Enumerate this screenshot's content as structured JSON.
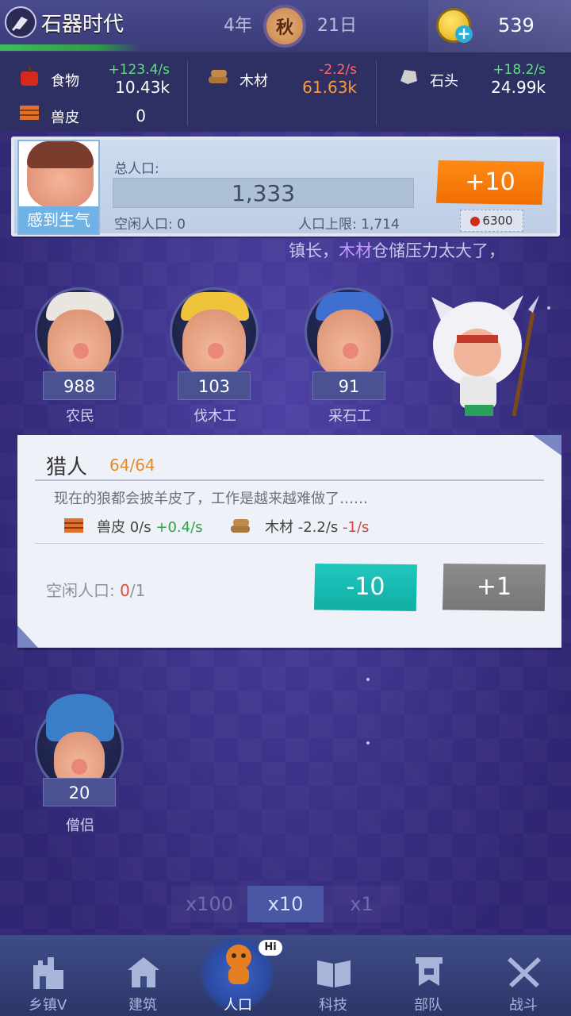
{
  "header": {
    "app_title": "石器时代",
    "year": "4年",
    "season": "秋",
    "day": "21日",
    "gold": "539"
  },
  "resources": [
    {
      "label": "食物",
      "rate": "+123.4/s",
      "amount": "10.43k",
      "icon": "apple-icon"
    },
    {
      "label": "木材",
      "rate": "-2.2/s",
      "amount": "61.63k",
      "icon": "wood-log-icon"
    },
    {
      "label": "石头",
      "rate": "+18.2/s",
      "amount": "24.99k",
      "icon": "stone-icon"
    },
    {
      "label": "兽皮",
      "amount": "0",
      "icon": "hide-icon"
    }
  ],
  "population": {
    "mood": "感到生气",
    "total_label": "总人口:",
    "total": "1,333",
    "idle_label": "空闲人口:",
    "idle": "0",
    "limit_label": "人口上限:",
    "limit": "1,714",
    "add_button": "+10",
    "cost": "6300"
  },
  "message": {
    "prefix": "镇长，",
    "highlight": "木材",
    "suffix": "仓储压力太大了，"
  },
  "workers": [
    {
      "name": "农民",
      "count": "988"
    },
    {
      "name": "伐木工",
      "count": "103"
    },
    {
      "name": "采石工",
      "count": "91"
    },
    {
      "name": "僧侣",
      "count": "20"
    }
  ],
  "hunter_card": {
    "title": "猎人",
    "count": "64/64",
    "description": "现在的狼都会披羊皮了，工作是越来越难做了……",
    "prod1_label": "兽皮",
    "prod1_base": "0/s",
    "prod1_delta": "+0.4/s",
    "prod2_label": "木材",
    "prod2_base": "-2.2/s",
    "prod2_delta": "-1/s",
    "idle_label": "空闲人口:",
    "idle_current": "0",
    "idle_total": "/1",
    "minus_button": "-10",
    "plus_button": "+1"
  },
  "multipliers": [
    "x100",
    "x10",
    "x1"
  ],
  "multiplier_selected": "x10",
  "nav": [
    {
      "label": "乡镇V",
      "icon": "castle-icon"
    },
    {
      "label": "建筑",
      "icon": "house-icon"
    },
    {
      "label": "人口",
      "icon": "population-icon",
      "badge": "Hi"
    },
    {
      "label": "科技",
      "icon": "book-icon"
    },
    {
      "label": "部队",
      "icon": "banner-icon"
    },
    {
      "label": "战斗",
      "icon": "crossed-swords-icon"
    }
  ],
  "colors": {
    "accent_orange": "#f07a0c",
    "accent_teal": "#17b8ae",
    "positive": "#5ee07a",
    "negative": "#ff6a6a"
  }
}
